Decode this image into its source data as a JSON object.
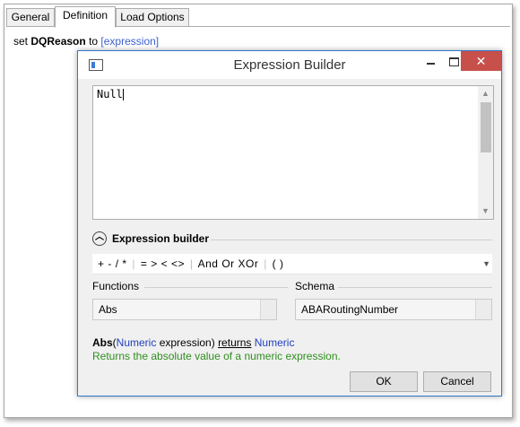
{
  "tabs": [
    "General",
    "Definition",
    "Load Options"
  ],
  "statement": {
    "prefix": "set",
    "field": "DQReason",
    "to": "to",
    "link": "[expression]"
  },
  "dialog": {
    "title": "Expression Builder",
    "controls": {
      "minimize": "minimize",
      "maximize": "maximize",
      "close": "✕"
    },
    "editor_text": "Null",
    "section_label": "Expression builder",
    "operators": {
      "arith": [
        "+",
        "-",
        "/",
        "*"
      ],
      "compare": [
        "=",
        ">",
        "<",
        "<>"
      ],
      "logical": [
        "And",
        "Or",
        "XOr"
      ],
      "parens": "( )"
    },
    "functions": {
      "label": "Functions",
      "selected": "Abs"
    },
    "schema": {
      "label": "Schema",
      "selected": "ABARoutingNumber"
    },
    "signature": {
      "name": "Abs",
      "open": "(",
      "arg_type": "Numeric",
      "arg_name": "expression",
      "close": ")",
      "returns_word": "returns",
      "return_type": "Numeric"
    },
    "description": "Returns the absolute value of a numeric expression.",
    "ok_label": "OK",
    "cancel_label": "Cancel"
  },
  "colors": {
    "link": "#3a5fcd",
    "type_blue": "#1f3fbf",
    "desc_green": "#2f8f1f",
    "close_red": "#c7504b",
    "border_blue": "#3079c8"
  }
}
